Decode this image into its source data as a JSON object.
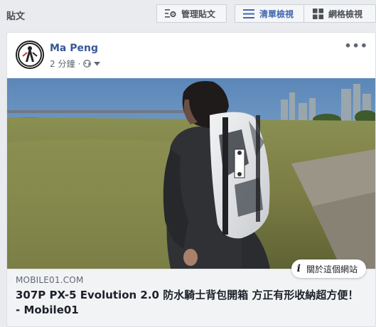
{
  "header": {
    "section_title": "貼文",
    "manage_label": "管理貼文",
    "list_view_label": "清單檢視",
    "grid_view_label": "網格檢視",
    "icons": {
      "manage": "gear-list-icon",
      "list": "list-icon",
      "grid": "grid-icon"
    },
    "accent_color": "#4267b2"
  },
  "post": {
    "author": "Ma Peng",
    "time": "2 分鐘",
    "separator": "·",
    "privacy_icon": "globe-icon",
    "more_icon": "more-icon",
    "more_label": "•••",
    "link": {
      "domain": "MOBILE01.COM",
      "title": "307P PX-5 Evolution 2.0 防水騎士背包開箱 方正有形收納超方便！ - Mobile01",
      "about_label": "關於這個網站",
      "about_icon": "info-icon"
    }
  }
}
